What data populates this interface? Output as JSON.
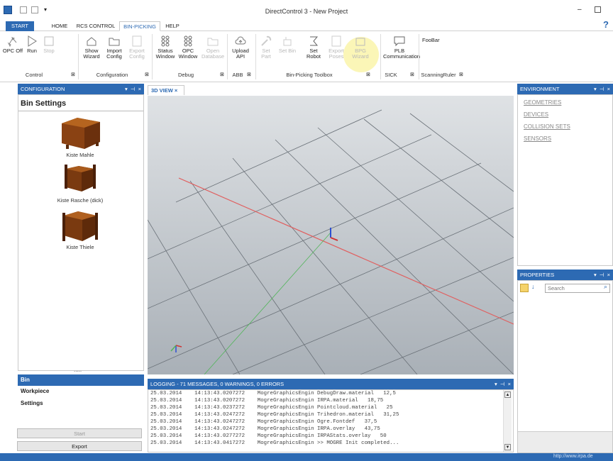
{
  "window": {
    "title": "DirectControl 3 - New Project",
    "help": "?"
  },
  "tabs": [
    {
      "label": "START"
    },
    {
      "label": "HOME"
    },
    {
      "label": "RCS CONTROL"
    },
    {
      "label": "BIN-PICKING"
    },
    {
      "label": "HELP"
    }
  ],
  "ribbon": {
    "buttons": [
      {
        "label": "OPC Off",
        "icon": "network-icon"
      },
      {
        "label": "Run",
        "icon": "play-icon"
      },
      {
        "label": "Stop",
        "icon": "stop-icon"
      },
      {
        "label": "Show Wizard",
        "icon": "wizard-icon"
      },
      {
        "label": "Import Config",
        "icon": "folder-icon"
      },
      {
        "label": "Export Config",
        "icon": "export-icon"
      },
      {
        "label": "Status Window",
        "icon": "status-icon"
      },
      {
        "label": "OPC Window",
        "icon": "opc-icon"
      },
      {
        "label": "Open Database",
        "icon": "database-icon"
      },
      {
        "label": "Upload API",
        "icon": "cloud-upload-icon"
      },
      {
        "label": "Set Part",
        "icon": "wrench-icon"
      },
      {
        "label": "Set Bin",
        "icon": "bin-icon"
      },
      {
        "label": "Set Robot",
        "icon": "robot-icon"
      },
      {
        "label": "Export Poses",
        "icon": "export-icon"
      },
      {
        "label": "BPG Wizard",
        "icon": "wizard-icon"
      },
      {
        "label": "PLB Communication",
        "icon": "speech-icon"
      }
    ],
    "groups": [
      "Control",
      "Configuration",
      "Debug",
      "ABB",
      "Bin-Picking Toolbox",
      "SICK",
      "ScanningRuler"
    ],
    "foobar": "FooBar"
  },
  "config": {
    "header": "CONFIGURATION",
    "title": "Bin Settings",
    "items": [
      {
        "label": "Kiste Mahle"
      },
      {
        "label": "Kiste Rasche (dick)"
      },
      {
        "label": "Kiste Thiele"
      }
    ],
    "grip": ".....",
    "nav": [
      {
        "label": "Bin"
      },
      {
        "label": "Workpiece"
      },
      {
        "label": "Settings"
      }
    ],
    "start": "Start",
    "export": "Export"
  },
  "view": {
    "tab": "3D VIEW ×"
  },
  "env": {
    "header": "ENVIRONMENT",
    "links": [
      "GEOMETRIES",
      "DEVICES",
      "COLLISION SETS",
      "SENSORS"
    ]
  },
  "props": {
    "header": "PROPERTIES",
    "search_placeholder": "Search"
  },
  "log": {
    "header": "LOGGING - 71 MESSAGES, 0 WARNINGS, 0 ERRORS",
    "lines": [
      "25.03.2014    14:13:43.0207272    MogreGraphicsEngin DebugDraw.material   12,5",
      "25.03.2014    14:13:43.0207272    MogreGraphicsEngin IRPA.material   18,75",
      "25.03.2014    14:13:43.0237272    MogreGraphicsEngin Pointcloud.material   25",
      "25.03.2014    14:13:43.0247272    MogreGraphicsEngin Trihedron.material   31,25",
      "25.03.2014    14:13:43.0247272    MogreGraphicsEngin Ogre.Fontdef   37,5",
      "25.03.2014    14:13:43.0247272    MogreGraphicsEngin IRPA.overlay   43,75",
      "25.03.2014    14:13:43.0277272    MogreGraphicsEngin IRPAStats.overlay   50",
      "25.03.2014    14:13:43.0417272    MogreGraphicsEngin >> MOGRE Init completed..."
    ]
  },
  "status": {
    "url": "http://www.irpa.de"
  },
  "colors": {
    "accent": "#2d6ab3"
  }
}
